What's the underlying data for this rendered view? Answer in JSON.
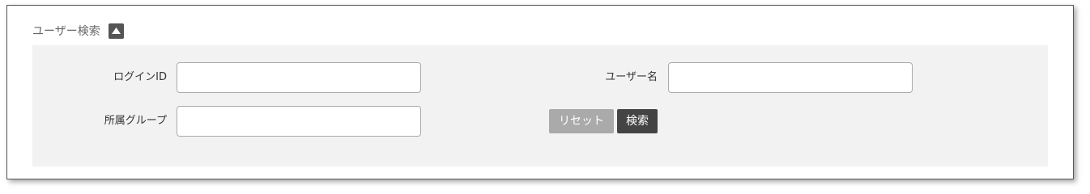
{
  "panel": {
    "title": "ユーザー検索",
    "collapse_icon": "triangle-up-icon"
  },
  "form": {
    "login_id": {
      "label": "ログインID",
      "value": ""
    },
    "user_name": {
      "label": "ユーザー名",
      "value": ""
    },
    "group": {
      "label": "所属グループ",
      "value": ""
    }
  },
  "buttons": {
    "reset_label": "リセット",
    "search_label": "検索"
  },
  "colors": {
    "panel_bg": "#f2f2f2",
    "reset_button": "#aaaaaa",
    "search_button": "#444444",
    "collapse_button": "#555555"
  }
}
